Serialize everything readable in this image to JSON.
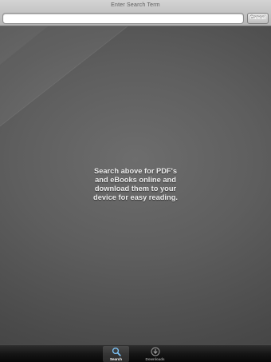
{
  "search": {
    "prompt": "Enter Search Term",
    "value": "",
    "placeholder": "",
    "cancel_label": "Cancel"
  },
  "main": {
    "message": "Search above for PDF's and eBooks online and download them to your device for easy reading."
  },
  "tabbar": {
    "tabs": [
      {
        "label": "Search",
        "icon": "search-icon",
        "selected": true
      },
      {
        "label": "Downloads",
        "icon": "download-icon",
        "selected": false
      }
    ]
  },
  "colors": {
    "search_bar_top": "#d4d4d4",
    "search_bar_bottom": "#b4b4b4",
    "background": "#5e5e5e",
    "tab_bar": "#141414",
    "message_text": "#ececec"
  }
}
